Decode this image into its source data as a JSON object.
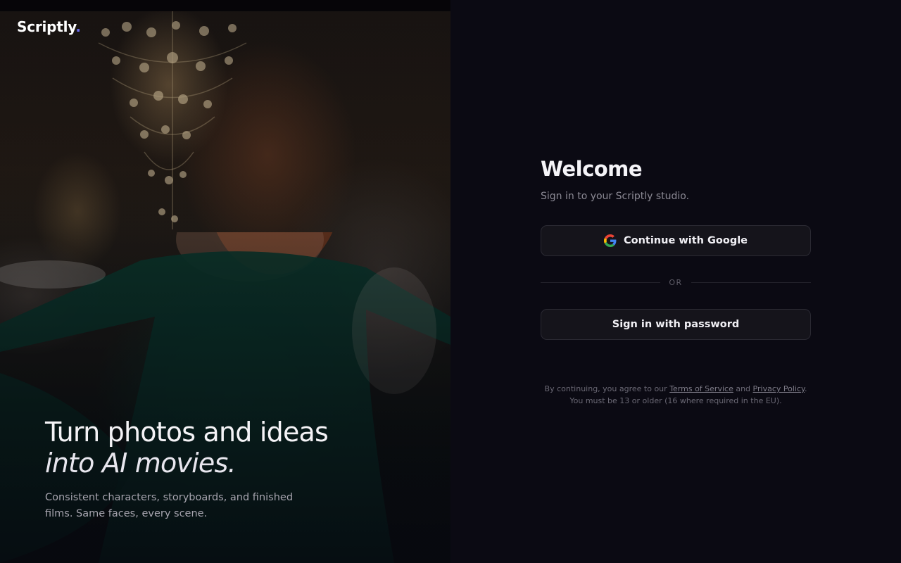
{
  "brand": {
    "name": "Scriptly",
    "dot": "."
  },
  "hero": {
    "headline_line1": "Turn photos and ideas",
    "headline_line2": "into AI movies.",
    "subcopy": "Consistent characters, storyboards, and finished films. Same faces, every scene."
  },
  "auth": {
    "title": "Welcome",
    "subtitle": "Sign in to your Scriptly studio.",
    "google_button": "Continue with Google",
    "divider": "OR",
    "password_button": "Sign in with password",
    "legal": {
      "prefix": "By continuing, you agree to our",
      "terms": "Terms of Service",
      "and": "and",
      "privacy": "Privacy Policy",
      "suffix": ".",
      "age_note": "You must be 13 or older (16 where required in the EU)."
    }
  },
  "colors": {
    "brand_accent": "#6b6cf0",
    "panel_bg": "#0b0a13",
    "button_bg": "#15141b"
  },
  "icons": {
    "google": "google-g-icon"
  }
}
